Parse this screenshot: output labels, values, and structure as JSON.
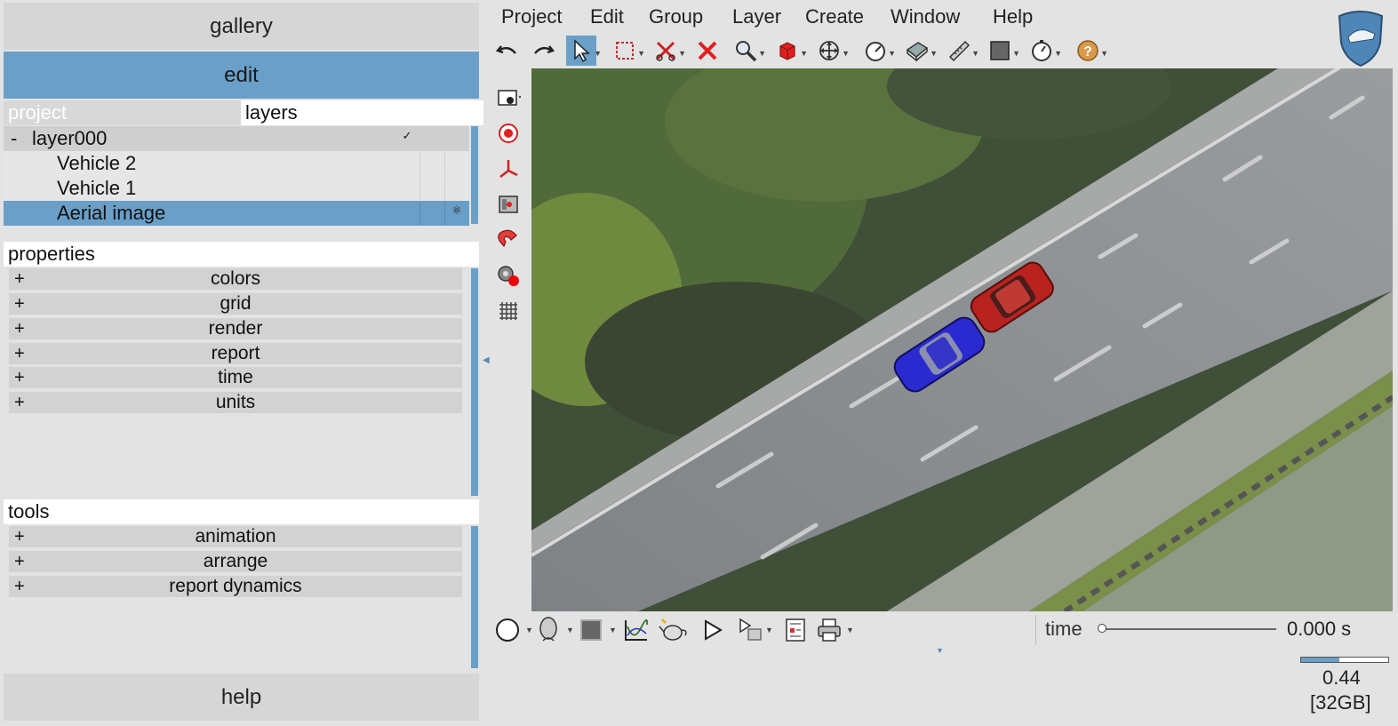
{
  "left_panel": {
    "gallery_label": "gallery",
    "edit_label": "edit",
    "help_label": "help",
    "tabs": {
      "project": "project",
      "layers": "layers"
    },
    "layers": {
      "group": {
        "toggle": "-",
        "name": "layer000",
        "visible_mark": "✓"
      },
      "items": [
        {
          "name": "Vehicle 2"
        },
        {
          "name": "Vehicle 1"
        },
        {
          "name": "Aerial image",
          "mark": "⚛"
        }
      ]
    },
    "properties": {
      "title": "properties",
      "items": [
        {
          "expander": "+",
          "label": "colors"
        },
        {
          "expander": "+",
          "label": "grid"
        },
        {
          "expander": "+",
          "label": "render"
        },
        {
          "expander": "+",
          "label": "report"
        },
        {
          "expander": "+",
          "label": "time"
        },
        {
          "expander": "+",
          "label": "units"
        }
      ]
    },
    "tools": {
      "title": "tools",
      "items": [
        {
          "expander": "+",
          "label": "animation"
        },
        {
          "expander": "+",
          "label": "arrange"
        },
        {
          "expander": "+",
          "label": "report dynamics"
        }
      ]
    }
  },
  "menu": [
    "Project",
    "Edit",
    "Group",
    "Layer",
    "Create",
    "Window",
    "Help"
  ],
  "toolbar_icons": [
    "undo-icon",
    "redo-icon",
    "select-icon",
    "box-select-icon",
    "scissors-icon",
    "delete-icon",
    "zoom-icon",
    "cube-icon",
    "move-icon",
    "speedometer-icon",
    "surface-icon",
    "measure-icon",
    "square-icon",
    "stopwatch-icon",
    "help-icon"
  ],
  "side_icons": [
    "camera-icon",
    "target-icon",
    "axes-icon",
    "image-icon",
    "magnet-icon",
    "settings-icon",
    "grid-icon"
  ],
  "bottom_icons": [
    "circle-icon",
    "head-icon",
    "color-swatch-icon",
    "graph-icon",
    "teapot-icon",
    "play-icon",
    "sequence-icon",
    "report-icon",
    "print-icon"
  ],
  "status": {
    "time_label": "time",
    "time_value": "0.000 s",
    "time_slider_fraction": 0,
    "memory_fraction": 0.44,
    "memory_value": "0.44",
    "memory_total": "[32GB]"
  },
  "colors": {
    "accent": "#6a9fc8",
    "panel": "#e3e3e3",
    "vehicle_1": "#2a2ad0",
    "vehicle_2": "#b8231f"
  }
}
